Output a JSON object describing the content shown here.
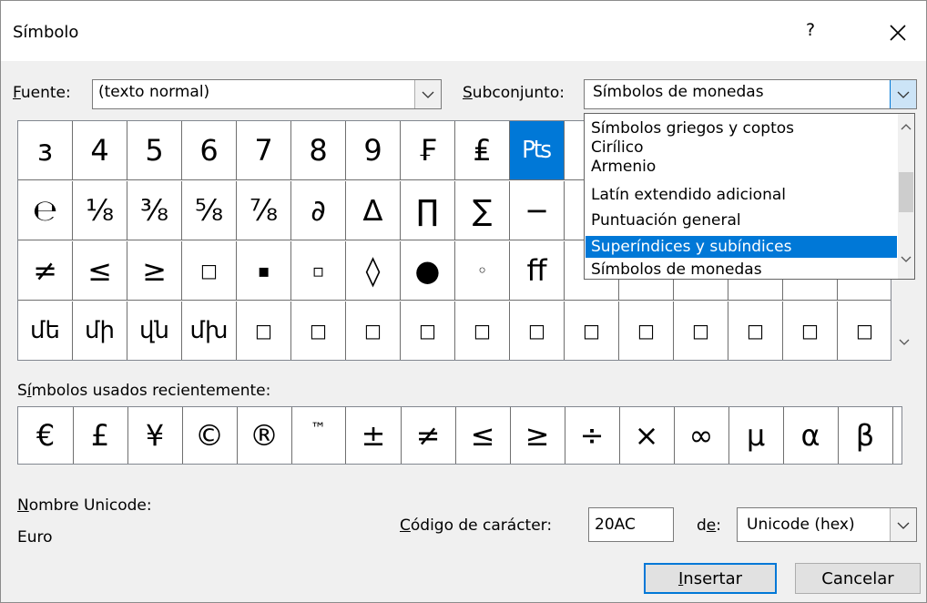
{
  "dialog": {
    "title": "Símbolo",
    "help_label": "?"
  },
  "font": {
    "label_accel": "F",
    "label_rest": "uente:",
    "value": "(texto normal)"
  },
  "subset": {
    "label_accel": "S",
    "label_rest": "ubconjunto:",
    "value": "Símbolos de monedas",
    "options": [
      "Símbolos griegos y coptos",
      "Cirílico",
      "Armenio",
      "Latín extendido adicional",
      "Puntuación general",
      "Superíndices y subíndices",
      "Símbolos de monedas"
    ],
    "highlighted_option": "Superíndices y subíndices"
  },
  "grid": {
    "rows": [
      [
        "з",
        "4",
        "5",
        "6",
        "7",
        "8",
        "9",
        "₣",
        "₤",
        "₧",
        "",
        "",
        "",
        "",
        "",
        ""
      ],
      [
        "℮",
        "⅛",
        "⅜",
        "⅝",
        "⅞",
        "∂",
        "∆",
        "∏",
        "∑",
        "−",
        "",
        "",
        "",
        "",
        "",
        ""
      ],
      [
        "≠",
        "≤",
        "≥",
        "□",
        "▪",
        "▫",
        "◊",
        "●",
        "◦",
        "ﬀ",
        "",
        "",
        "",
        "",
        "",
        ""
      ],
      [
        "մե",
        "մի",
        "վն",
        "մխ",
        "□",
        "□",
        "□",
        "□",
        "□",
        "□",
        "□",
        "□",
        "□",
        "□",
        "□",
        "□"
      ]
    ],
    "selected": "₧"
  },
  "recent": {
    "label_pre": "S",
    "label_accel": "í",
    "label_rest": "mbolos usados recientemente:",
    "symbols": [
      "€",
      "£",
      "¥",
      "©",
      "®",
      "™",
      "±",
      "≠",
      "≤",
      "≥",
      "÷",
      "×",
      "∞",
      "µ",
      "α",
      "β"
    ]
  },
  "unicode_name": {
    "label_accel": "N",
    "label_rest": "ombre Unicode:",
    "value": "Euro"
  },
  "char_code": {
    "label_accel": "C",
    "label_rest": "ódigo de carácter:",
    "value": "20AC"
  },
  "from": {
    "label_pre": "d",
    "label_accel": "e",
    "label_rest": ":",
    "value": "Unicode (hex)"
  },
  "buttons": {
    "insert_accel": "I",
    "insert_rest": "nsertar",
    "cancel": "Cancelar"
  }
}
